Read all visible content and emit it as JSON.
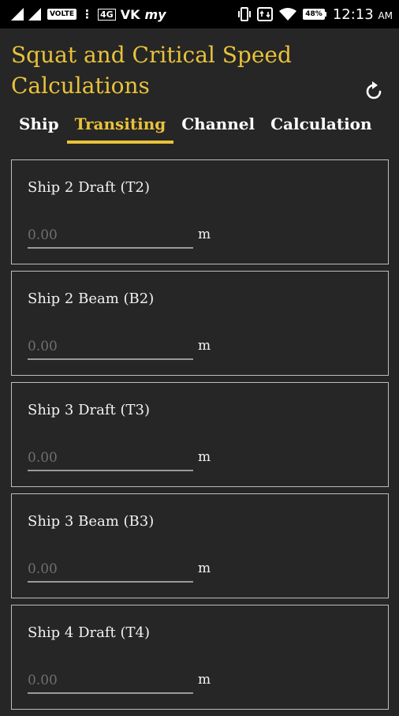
{
  "status_bar": {
    "volte": "VOLTE",
    "sim_badge": "4G",
    "carrier": "VK",
    "app_badge": "my",
    "battery": "48%",
    "time": "12:13",
    "ampm": "AM"
  },
  "header": {
    "title": "Squat and Critical Speed Calculations",
    "reset_icon": "refresh-icon"
  },
  "tabs": [
    {
      "label": "Ship",
      "active": false
    },
    {
      "label": "Transiting",
      "active": true
    },
    {
      "label": "Channel",
      "active": false
    },
    {
      "label": "Calculation",
      "active": false
    }
  ],
  "fields": [
    {
      "label": "Ship 2 Draft (T2)",
      "placeholder": "0.00",
      "value": "",
      "unit": "m"
    },
    {
      "label": "Ship 2 Beam (B2)",
      "placeholder": "0.00",
      "value": "",
      "unit": "m"
    },
    {
      "label": "Ship 3 Draft (T3)",
      "placeholder": "0.00",
      "value": "",
      "unit": "m"
    },
    {
      "label": "Ship 3 Beam (B3)",
      "placeholder": "0.00",
      "value": "",
      "unit": "m"
    },
    {
      "label": "Ship 4 Draft (T4)",
      "placeholder": "0.00",
      "value": "",
      "unit": "m"
    }
  ],
  "colors": {
    "accent": "#e8c23a",
    "background": "#262626",
    "status_bar": "#000000",
    "card_border": "#bdbdbd"
  }
}
